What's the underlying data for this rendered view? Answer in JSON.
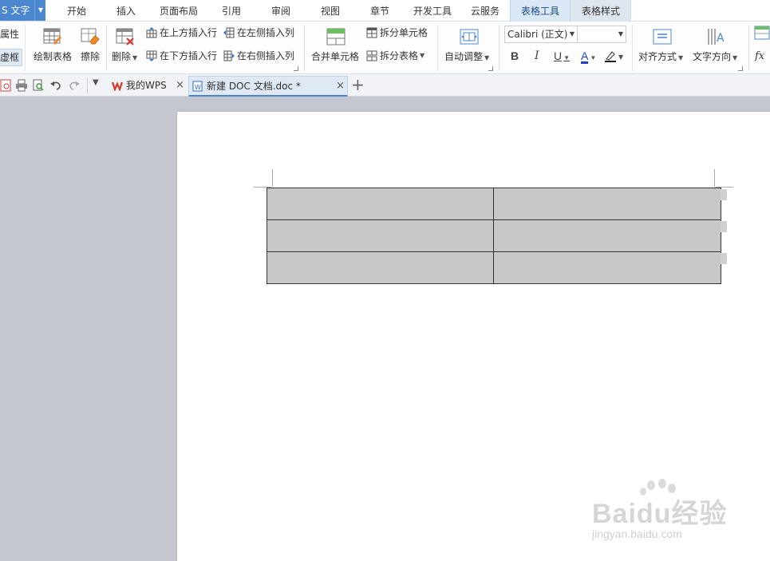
{
  "app": {
    "title": "S 文字",
    "menu_tabs": [
      {
        "label": "开始"
      },
      {
        "label": "插入"
      },
      {
        "label": "页面布局"
      },
      {
        "label": "引用"
      },
      {
        "label": "审阅"
      },
      {
        "label": "视图"
      },
      {
        "label": "章节"
      },
      {
        "label": "开发工具"
      },
      {
        "label": "云服务"
      },
      {
        "label": "表格工具"
      },
      {
        "label": "表格样式"
      }
    ],
    "active_tab": "表格工具"
  },
  "ribbon": {
    "properties_label": "属性",
    "dashed_border_label": "虚框",
    "draw_table_label": "绘制表格",
    "erase_label": "擦除",
    "delete_label": "删除",
    "insert_row_above_label": "在上方插入行",
    "insert_row_below_label": "在下方插入行",
    "insert_col_left_label": "在左侧插入列",
    "insert_col_right_label": "在右侧插入列",
    "merge_cells_label": "合并单元格",
    "split_cells_label": "拆分单元格",
    "split_table_label": "拆分表格",
    "auto_fit_label": "自动调整",
    "font_name": "Calibri (正文)",
    "font_size": "",
    "bold_label": "B",
    "italic_label": "I",
    "underline_label": "U",
    "font_color_label": "A",
    "align_label": "对齐方式",
    "text_direction_label": "文字方向",
    "formula_label": "fx"
  },
  "tabs": {
    "home_tab_label": "我的WPS",
    "doc_tab_label": "新建 DOC 文档.doc *",
    "close_glyph": "×",
    "new_tab_glyph": "+"
  },
  "document": {
    "table": {
      "rows": 3,
      "cols": 2
    }
  },
  "watermark": {
    "brand": "Baidu经验",
    "url": "jingyan.baidu.com"
  },
  "colors": {
    "accent": "#4b86cf",
    "active_tab_bg": "#dbe8f7",
    "cell_fill": "#c8c8c8",
    "workspace_bg": "#c4c7cf"
  }
}
